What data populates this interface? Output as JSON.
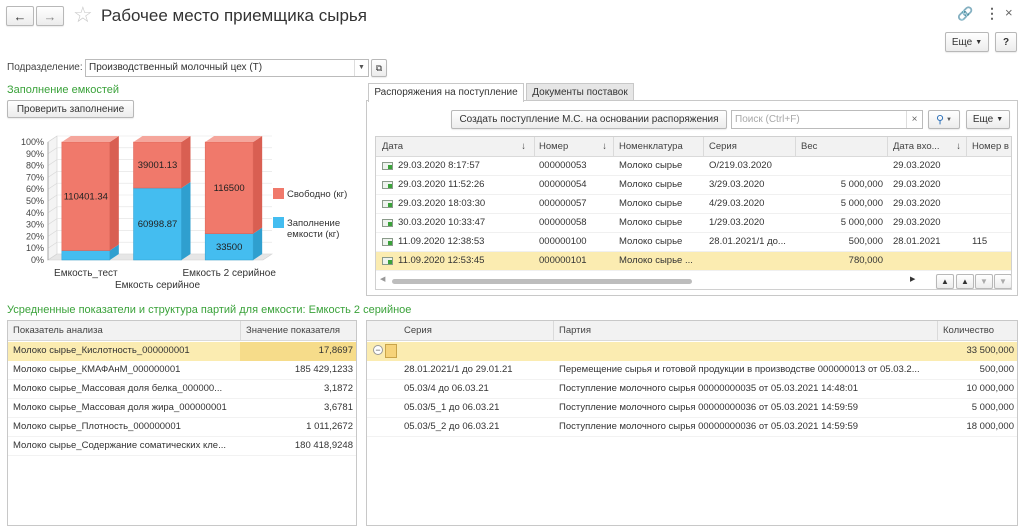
{
  "window": {
    "title": "Рабочее место приемщика сырья",
    "more_label": "Еще",
    "help_label": "?"
  },
  "department": {
    "label": "Подразделение:",
    "value": "Производственный молочный цех (Т)"
  },
  "tank_fill": {
    "title": "Заполнение емкостей",
    "check_button": "Проверить заполнение"
  },
  "chart_data": {
    "type": "bar",
    "stacked": true,
    "categories": [
      "Емкость_тест",
      "Емкость серийное",
      "Емкость 2 серийное"
    ],
    "series": [
      {
        "name": "Заполнение емкости (кг)",
        "values": [
          9598.66,
          60998.87,
          33500
        ],
        "labels": [
          "",
          "60998.87",
          "33500"
        ],
        "color": "#44bdf0"
      },
      {
        "name": "Свободно (кг)",
        "values": [
          110401.34,
          39001.13,
          116500
        ],
        "labels": [
          "110401.34",
          "39001.13",
          "116500"
        ],
        "color": "#f0796b"
      }
    ],
    "y_ticks": [
      "0%",
      "10%",
      "20%",
      "30%",
      "40%",
      "50%",
      "60%",
      "70%",
      "80%",
      "90%",
      "100%"
    ],
    "ylim": [
      0,
      100
    ],
    "legend": [
      {
        "label": "Свободно (кг)",
        "color": "#f0796b"
      },
      {
        "label": "Заполнение емкости (кг)",
        "color": "#44bdf0"
      }
    ],
    "legend_placement": "right"
  },
  "receipts": {
    "tabs": [
      {
        "label": "Распоряжения на поступление",
        "active": true
      },
      {
        "label": "Документы поставок",
        "active": false
      }
    ],
    "create_button": "Создать поступление М.С. на основании распоряжения",
    "search_placeholder": "Поиск (Ctrl+F)",
    "more_label": "Еще",
    "columns": [
      "Дата",
      "Номер",
      "Номенклатура",
      "Серия",
      "Вес",
      "Дата вхо...",
      "Номер в"
    ],
    "rows": [
      {
        "date": "29.03.2020 8:17:57",
        "number": "000000053",
        "item": "Молоко сырье",
        "series": "О/219.03.2020",
        "weight": "",
        "date_in": "29.03.2020",
        "num_in": "",
        "selected": false
      },
      {
        "date": "29.03.2020 11:52:26",
        "number": "000000054",
        "item": "Молоко сырье",
        "series": "3/29.03.2020",
        "weight": "5 000,000",
        "date_in": "29.03.2020",
        "num_in": "",
        "selected": false
      },
      {
        "date": "29.03.2020 18:03:30",
        "number": "000000057",
        "item": "Молоко сырье",
        "series": "4/29.03.2020",
        "weight": "5 000,000",
        "date_in": "29.03.2020",
        "num_in": "",
        "selected": false
      },
      {
        "date": "30.03.2020 10:33:47",
        "number": "000000058",
        "item": "Молоко сырье",
        "series": "1/29.03.2020",
        "weight": "5 000,000",
        "date_in": "29.03.2020",
        "num_in": "",
        "selected": false
      },
      {
        "date": "11.09.2020 12:38:53",
        "number": "000000100",
        "item": "Молоко сырье",
        "series": "28.01.2021/1 до...",
        "weight": "500,000",
        "date_in": "28.01.2021",
        "num_in": "115",
        "selected": false
      },
      {
        "date": "11.09.2020 12:53:45",
        "number": "000000101",
        "item": "Молоко сырье ...",
        "series": "",
        "weight": "780,000",
        "date_in": "",
        "num_in": "",
        "selected": true
      }
    ]
  },
  "averages": {
    "title": "Усредненные показатели и структура партий для емкости: Емкость 2 серийное",
    "columns": [
      "Показатель анализа",
      "Значение показателя"
    ],
    "rows": [
      {
        "name": "Молоко сырье_Кислотность_000000001",
        "value": "17,8697",
        "selected": true
      },
      {
        "name": "Молоко сырье_КМАФАнМ_000000001",
        "value": "185 429,1233",
        "selected": false
      },
      {
        "name": "Молоко сырье_Массовая доля белка_000000...",
        "value": "3,1872",
        "selected": false
      },
      {
        "name": "Молоко сырье_Массовая доля жира_000000001",
        "value": "3,6781",
        "selected": false
      },
      {
        "name": "Молоко сырье_Плотность_000000001",
        "value": "1 011,2672",
        "selected": false
      },
      {
        "name": "Молоко сырье_Содержание соматических кле...",
        "value": "180 418,9248",
        "selected": false
      }
    ]
  },
  "batches": {
    "columns": [
      "Серия",
      "Партия",
      "Количество"
    ],
    "group_total": "33 500,000",
    "rows": [
      {
        "series": "28.01.2021/1 до 29.01.21",
        "batch": "Перемещение сырья и готовой продукции в производстве 000000013 от 05.03.2...",
        "qty": "500,000"
      },
      {
        "series": "05.03/4 до 06.03.21",
        "batch": "Поступление молочного сырья 00000000035 от 05.03.2021 14:48:01",
        "qty": "10 000,000"
      },
      {
        "series": "05.03/5_1 до 06.03.21",
        "batch": "Поступление молочного сырья 00000000036 от 05.03.2021 14:59:59",
        "qty": "5 000,000"
      },
      {
        "series": "05.03/5_2 до 06.03.21",
        "batch": "Поступление молочного сырья 00000000036 от 05.03.2021 14:59:59",
        "qty": "18 000,000"
      }
    ]
  },
  "colors": {
    "accent_green": "#3aa23a",
    "selected_row": "#fbecb1",
    "header_bg": "#f2f2f2"
  }
}
